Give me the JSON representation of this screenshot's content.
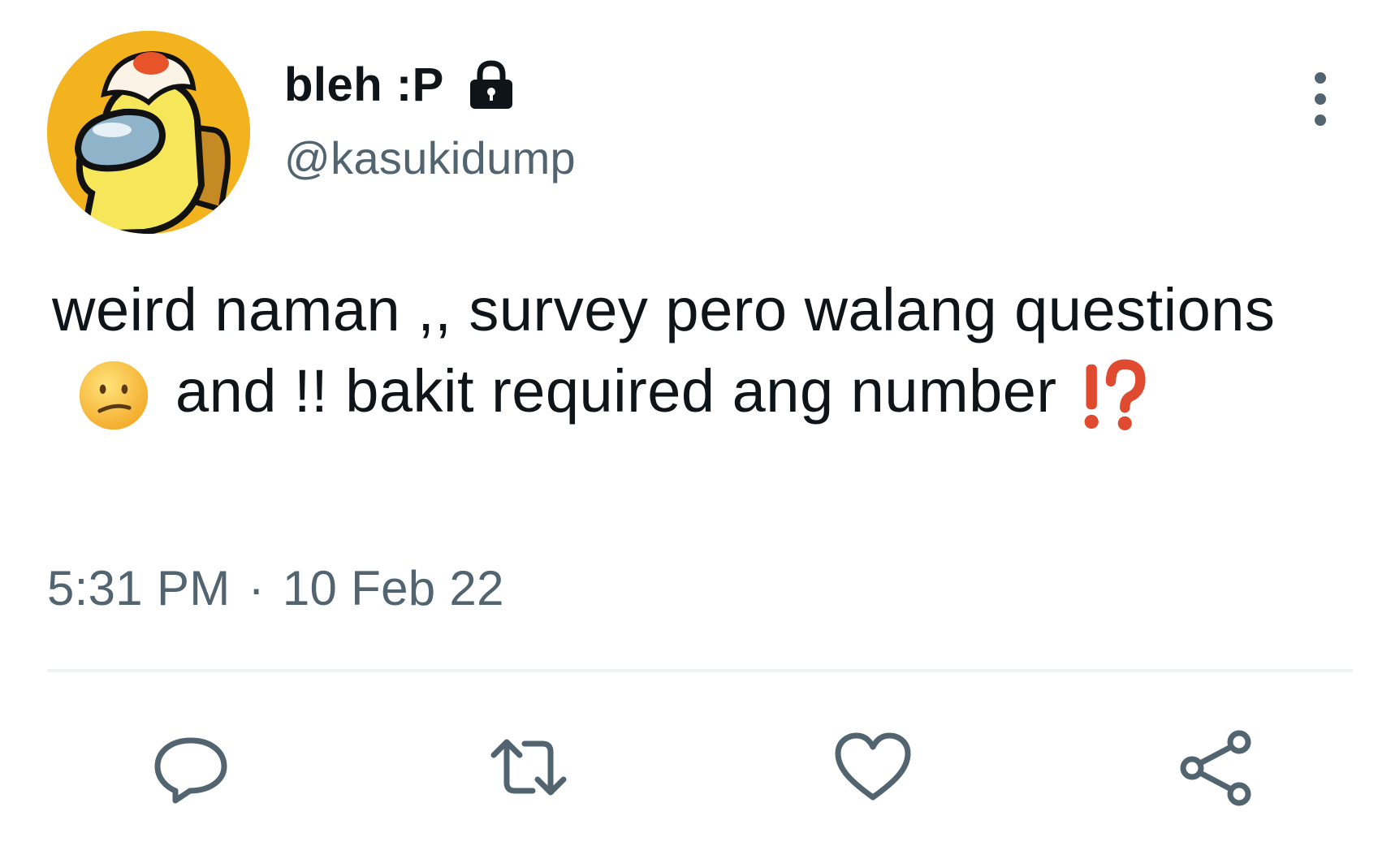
{
  "author": {
    "display_name": "bleh :P",
    "handle": "@kasukidump",
    "avatar_icon": "yellow-crewmate-avatar",
    "protected_icon": "lock-icon"
  },
  "tweet": {
    "text_part1": "weird naman ,, survey pero walang questions",
    "emoji1": "confused-face-emoji",
    "text_part2": "and !! bakit required ang number",
    "emoji2": "exclamation-question-mark-emoji"
  },
  "meta": {
    "time": "5:31 PM",
    "separator": "·",
    "date": "10 Feb 22"
  },
  "actions": [
    {
      "name": "reply",
      "icon": "reply-icon"
    },
    {
      "name": "retweet",
      "icon": "retweet-icon"
    },
    {
      "name": "like",
      "icon": "heart-icon"
    },
    {
      "name": "share",
      "icon": "share-icon"
    }
  ],
  "colors": {
    "text": "#0f1419",
    "secondary_text": "#536471",
    "icon": "#536471",
    "divider": "#eff3f4",
    "avatar_bg": "#f3b31f"
  }
}
